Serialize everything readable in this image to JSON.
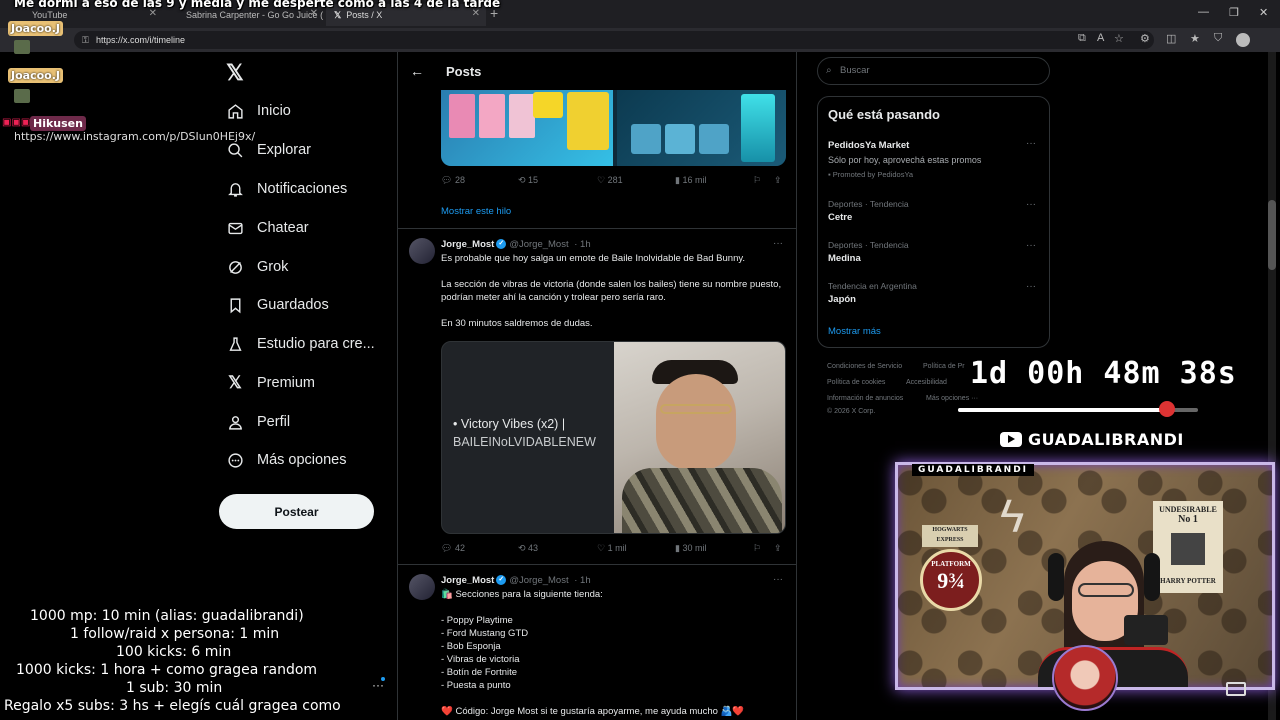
{
  "browser": {
    "tabs": [
      {
        "title": "YouTube"
      },
      {
        "title": "Sabrina Carpenter - Go Go Juice (…"
      },
      {
        "title": "Posts / X"
      }
    ],
    "url": "https://x.com/i/timeline"
  },
  "stream_overlay": {
    "top_caption": "Me dormí a eso de las 9 y media y me desperté como a las 4 de la tarde",
    "chat": [
      {
        "user": "Joacoo.J"
      },
      {
        "user": "Joacoo.J"
      },
      {
        "user": "Hikusen",
        "message": "https://www.instagram.com/p/DSIun0HEj9x/"
      }
    ],
    "goals": [
      "1000 mp: 10 min (alias: guadalibrandi)",
      "1 follow/raid x persona: 1 min",
      "100 kicks: 6 min",
      "1000 kicks: 1 hora + como gragea random",
      "1 sub: 30 min",
      "Regalo x5 subs: 3 hs + elegís cuál gragea como"
    ],
    "timer": "1d 00h 48m 38s",
    "timer_progress": 0.87,
    "youtube_channel": "GUADALIBRANDI",
    "cam_label": "GUADALIBRANDI",
    "cam_props": {
      "poster_title": "UNDESIRABLE",
      "poster_no": "No 1",
      "poster_name": "HARRY POTTER",
      "sign_line1": "HOGWARTS",
      "sign_line2": "EXPRESS",
      "platform_text": "PLATFORM",
      "platform_number": "9¾"
    }
  },
  "x": {
    "nav": [
      {
        "label": "Inicio",
        "icon": "home-icon"
      },
      {
        "label": "Explorar",
        "icon": "search-icon"
      },
      {
        "label": "Notificaciones",
        "icon": "bell-icon"
      },
      {
        "label": "Chatear",
        "icon": "mail-icon"
      },
      {
        "label": "Grok",
        "icon": "grok-icon"
      },
      {
        "label": "Guardados",
        "icon": "bookmark-icon"
      },
      {
        "label": "Estudio para cre...",
        "icon": "flask-icon"
      },
      {
        "label": "Premium",
        "icon": "x-icon"
      },
      {
        "label": "Perfil",
        "icon": "person-icon"
      },
      {
        "label": "Más opciones",
        "icon": "more-circle-icon"
      }
    ],
    "post_button": "Postear",
    "header_title": "Posts",
    "first_post_actions": {
      "replies": "28",
      "reposts": "15",
      "likes": "281",
      "views": "16 mil"
    },
    "show_thread": "Mostrar este hilo",
    "post2": {
      "name": "Jorge_Most",
      "handle": "@Jorge_Most",
      "time": "· 1h",
      "text": "Es probable que hoy salga un emote de Baile Inolvidable de Bad Bunny.\n\nLa sección de vibras de victoria (donde salen los bailes) tiene su nombre puesto, podrían meter ahí la canción y trolear pero sería raro.\n\nEn 30 minutos saldremos de dudas.",
      "card_line1": "• Victory Vibes (x2) |",
      "card_line2": "BAILEINoLVIDABLENEW",
      "actions": {
        "replies": "42",
        "reposts": "43",
        "likes": "1 mil",
        "views": "30 mil"
      }
    },
    "post3": {
      "name": "Jorge_Most",
      "handle": "@Jorge_Most",
      "time": "· 1h",
      "text": "🛍️ Secciones para la siguiente tienda:\n\n- Poppy Playtime\n- Ford Mustang GTD\n- Bob Esponja\n- Vibras de victoria\n- Botín de Fortnite\n- Puesta a punto\n\n❤️ Código: Jorge Most si te gustaría apoyarme, me ayuda mucho 🫂❤️"
    },
    "search_placeholder": "Buscar",
    "trends_title": "Qué está pasando",
    "trends": [
      {
        "meta": "",
        "name": "PedidosYa Market",
        "desc": "Sólo por hoy, aprovechá estas promos",
        "promo": "Promoted by PedidosYa"
      },
      {
        "meta": "Deportes · Tendencia",
        "name": "Cetre"
      },
      {
        "meta": "Deportes · Tendencia",
        "name": "Medina"
      },
      {
        "meta": "Tendencia en Argentina",
        "name": "Japón"
      }
    ],
    "show_more": "Mostrar más",
    "footer": {
      "l1a": "Condiciones de Servicio",
      "l1b": "Política de Pr",
      "l2a": "Política de cookies",
      "l2b": "Accesibilidad",
      "l3a": "Información de anuncios",
      "l3b": "Más opciones ···",
      "copyright": "© 2026 X Corp."
    }
  }
}
